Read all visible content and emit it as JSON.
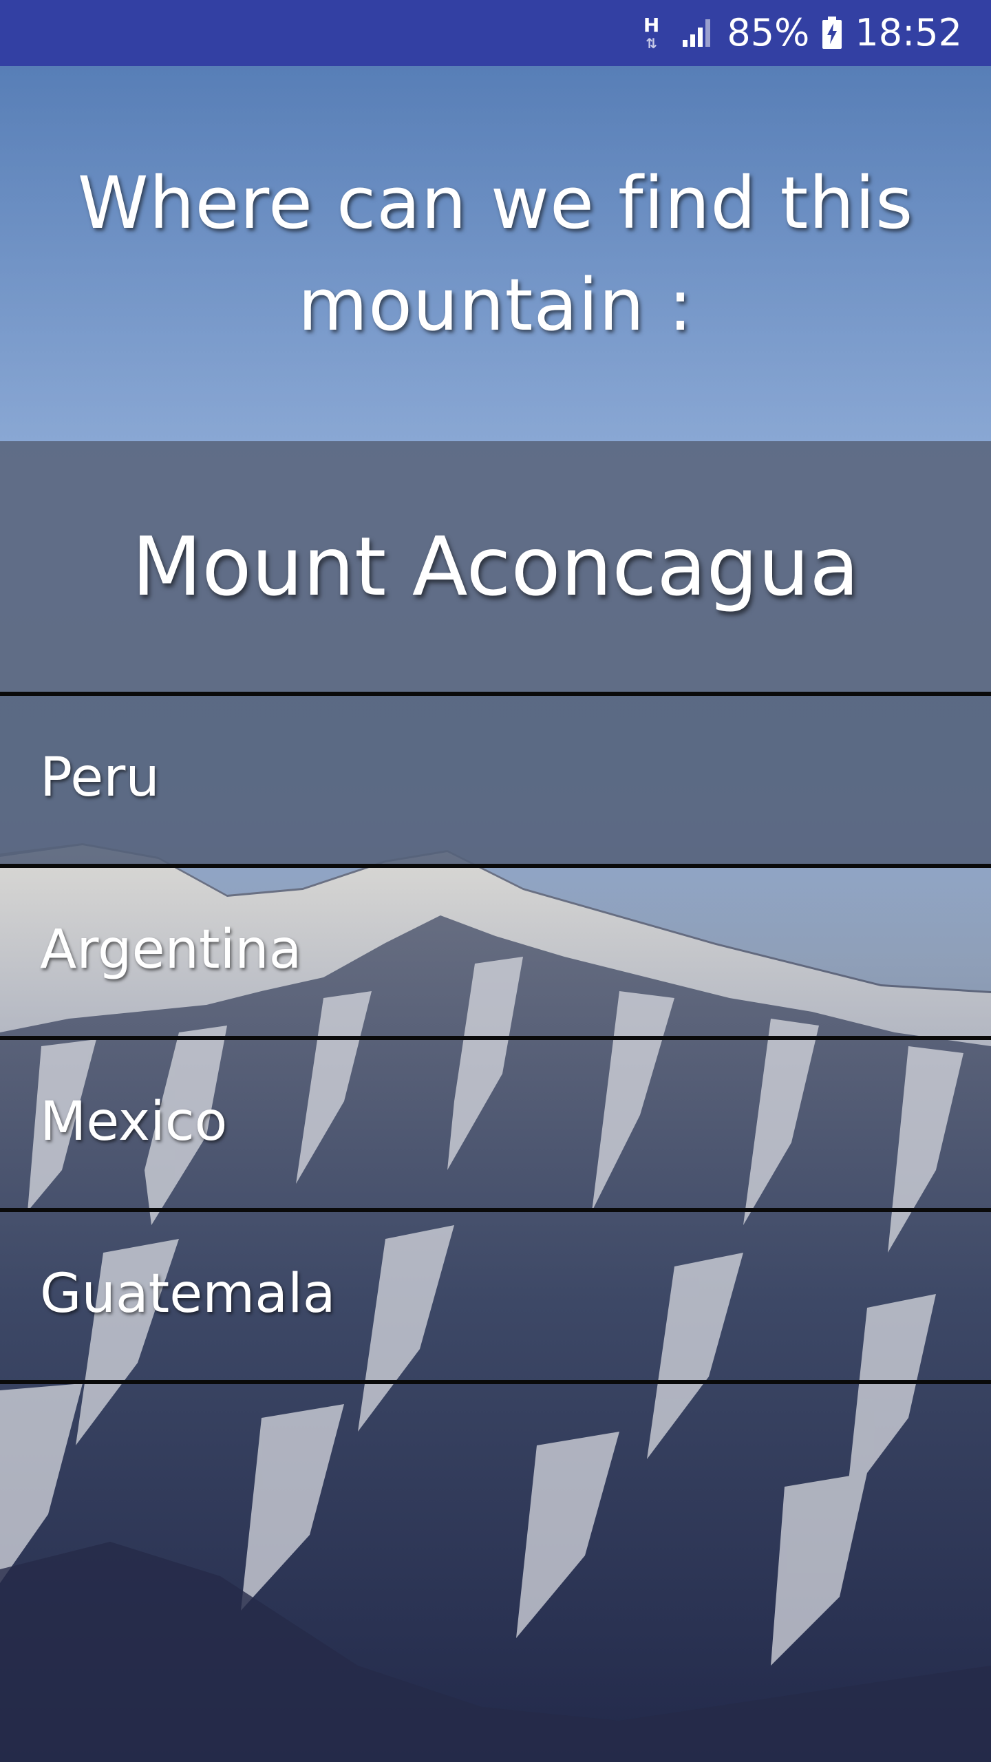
{
  "status_bar": {
    "network_type": "H",
    "network_arrows": "⇅",
    "battery_percent": "85%",
    "time": "18:52"
  },
  "question": {
    "prompt": "Where can we find this mountain :",
    "subject": "Mount Aconcagua"
  },
  "answers": [
    {
      "label": "Peru"
    },
    {
      "label": "Argentina"
    },
    {
      "label": "Mexico"
    },
    {
      "label": "Guatemala"
    }
  ],
  "background": {
    "image": "snow-covered-mountain-photo",
    "sky_color": "#6f93c6",
    "status_bar_color": "#3340a3"
  }
}
